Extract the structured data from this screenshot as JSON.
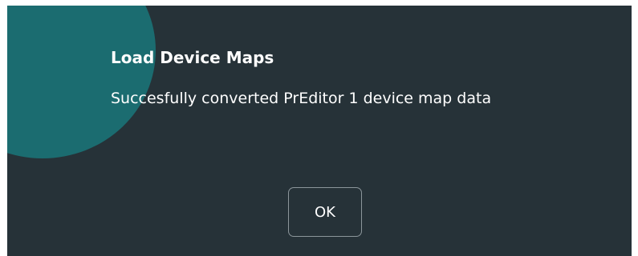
{
  "dialog": {
    "icon": "info-icon",
    "title": "Load Device Maps",
    "message": "Succesfully converted PrEditor 1 device map data",
    "ok_label": "OK",
    "colors": {
      "background": "#263238",
      "icon_circle": "#1b6c70",
      "text": "#ffffff",
      "button_border": "#8c969b"
    }
  }
}
